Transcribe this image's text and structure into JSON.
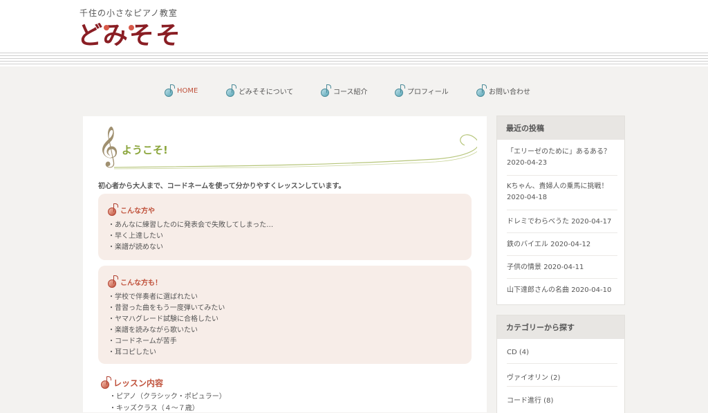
{
  "header": {
    "subtitle": "千住の小さなピアノ教室",
    "logo_text": "どみそそ"
  },
  "nav": {
    "items": [
      {
        "label": "HOME",
        "active": true
      },
      {
        "label": "どみそそについて",
        "active": false
      },
      {
        "label": "コース紹介",
        "active": false
      },
      {
        "label": "プロフィール",
        "active": false
      },
      {
        "label": "お問い合わせ",
        "active": false
      }
    ]
  },
  "main": {
    "welcome_title": "ようこそ!",
    "intro": "初心者から大人まで、コードネームを使って分かりやすくレッスンしています。",
    "box1": {
      "title": "こんな方や",
      "items": [
        "・あんなに練習したのに発表会で失敗してしまった…",
        "・早く上達したい",
        "・楽譜が読めない"
      ]
    },
    "box2": {
      "title": "こんな方も！",
      "items": [
        "・学校で伴奏者に選ばれたい",
        "・昔習った曲をもう一度弾いてみたい",
        "・ヤマハグレード試験に合格したい",
        "・楽譜を読みながら歌いたい",
        "・コードネームが苦手",
        "・耳コピしたい"
      ]
    },
    "lesson": {
      "title": "レッスン内容",
      "items": [
        "・ピアノ（クラシック・ポピュラー）",
        "・キッズクラス（４〜７歳）"
      ]
    }
  },
  "sidebar": {
    "recent": {
      "title": "最近の投稿",
      "posts": [
        {
          "title": "「エリーゼのために」あるある？",
          "date": "2020-04-23"
        },
        {
          "title": "Kちゃん、貴婦人の乗馬に挑戦！",
          "date": "2020-04-18"
        },
        {
          "title": "ドレミでわらべうた",
          "date": "2020-04-17"
        },
        {
          "title": "鉄のバイエル",
          "date": "2020-04-12"
        },
        {
          "title": "子供の情景",
          "date": "2020-04-11"
        },
        {
          "title": "山下達郎さんの名曲",
          "date": "2020-04-10"
        }
      ]
    },
    "categories": {
      "title": "カテゴリーから探す",
      "items": [
        "CD (4)",
        "ヴァイオリン (2)",
        "コード進行 (8)"
      ]
    }
  },
  "colors": {
    "accent_red": "#c0523c",
    "accent_green": "#8aa53a",
    "logo": "#8a1e24",
    "nav_note": "#5aa7b8"
  }
}
